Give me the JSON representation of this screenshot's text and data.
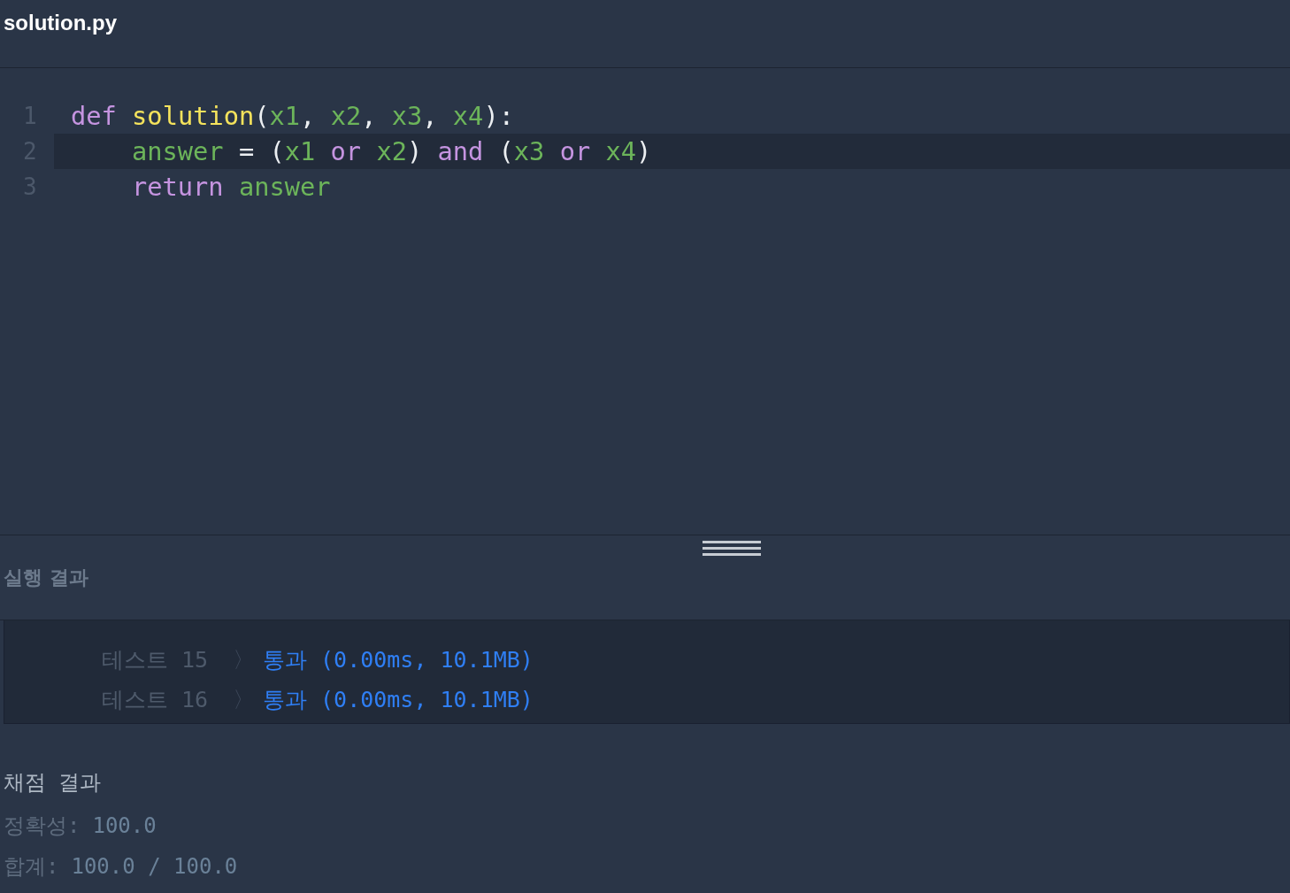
{
  "header": {
    "filename": "solution.py"
  },
  "editor": {
    "lines": [
      {
        "number": "1",
        "active": false,
        "indented": false,
        "tokens": [
          {
            "text": "def ",
            "kind": "keyword"
          },
          {
            "text": "solution",
            "kind": "function"
          },
          {
            "text": "(",
            "kind": "plain"
          },
          {
            "text": "x1",
            "kind": "name"
          },
          {
            "text": ", ",
            "kind": "plain"
          },
          {
            "text": "x2",
            "kind": "name"
          },
          {
            "text": ", ",
            "kind": "plain"
          },
          {
            "text": "x3",
            "kind": "name"
          },
          {
            "text": ", ",
            "kind": "plain"
          },
          {
            "text": "x4",
            "kind": "name"
          },
          {
            "text": "):",
            "kind": "plain"
          }
        ]
      },
      {
        "number": "2",
        "active": true,
        "indented": true,
        "tokens": [
          {
            "text": "answer",
            "kind": "name"
          },
          {
            "text": " = (",
            "kind": "plain"
          },
          {
            "text": "x1",
            "kind": "name"
          },
          {
            "text": " or ",
            "kind": "keyword"
          },
          {
            "text": "x2",
            "kind": "name"
          },
          {
            "text": ") ",
            "kind": "plain"
          },
          {
            "text": "and",
            "kind": "keyword"
          },
          {
            "text": " (",
            "kind": "plain"
          },
          {
            "text": "x3",
            "kind": "name"
          },
          {
            "text": " or ",
            "kind": "keyword"
          },
          {
            "text": "x4",
            "kind": "name"
          },
          {
            "text": ")",
            "kind": "plain"
          }
        ]
      },
      {
        "number": "3",
        "active": false,
        "indented": true,
        "tokens": [
          {
            "text": "return ",
            "kind": "keyword"
          },
          {
            "text": "answer",
            "kind": "name"
          }
        ]
      }
    ]
  },
  "results_panel": {
    "title": "실행 결과",
    "rows": [
      {
        "label": "테스트 15",
        "separator": "〉",
        "result": "통과 (0.00ms, 10.1MB)"
      },
      {
        "label": "테스트 16",
        "separator": "〉",
        "result": "통과 (0.00ms, 10.1MB)"
      }
    ]
  },
  "grading": {
    "title": "채점 결과",
    "lines": [
      {
        "label": "정확성:",
        "value": "100.0"
      },
      {
        "label": "합계:",
        "value": "100.0 / 100.0"
      }
    ]
  }
}
